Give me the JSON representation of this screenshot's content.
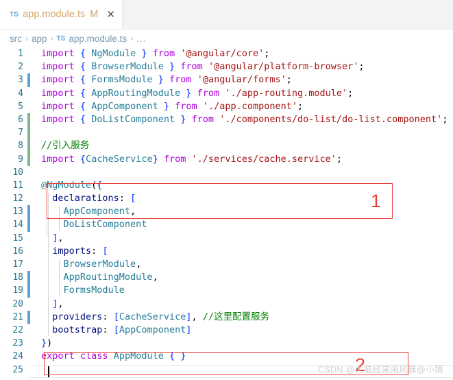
{
  "tab": {
    "file_icon": "typescript-file-icon",
    "file_icon_label": "TS",
    "filename": "app.module.ts",
    "dirty_indicator": "M",
    "close_icon": "close-icon",
    "close_glyph": "✕"
  },
  "breadcrumb": {
    "items": [
      "src",
      "app",
      "app.module.ts"
    ],
    "separator": "›",
    "ts_label": "TS",
    "overflow": "..."
  },
  "code": {
    "lines": [
      {
        "n": "1",
        "marker": "none",
        "text": "import { NgModule } from '@angular/core';"
      },
      {
        "n": "2",
        "marker": "none",
        "text": "import { BrowserModule } from '@angular/platform-browser';"
      },
      {
        "n": "3",
        "marker": "modified",
        "text": "import { FormsModule } from '@angular/forms';"
      },
      {
        "n": "4",
        "marker": "none",
        "text": "import { AppRoutingModule } from './app-routing.module';"
      },
      {
        "n": "5",
        "marker": "none",
        "text": "import { AppComponent } from './app.component';"
      },
      {
        "n": "6",
        "marker": "added",
        "text": "import { DoListComponent } from './components/do-list/do-list.component';"
      },
      {
        "n": "7",
        "marker": "added",
        "text": ""
      },
      {
        "n": "8",
        "marker": "added",
        "text": "//引入服务"
      },
      {
        "n": "9",
        "marker": "added",
        "text": "import {CacheService} from './services/cache.service';"
      },
      {
        "n": "10",
        "marker": "none",
        "text": ""
      },
      {
        "n": "11",
        "marker": "none",
        "text": "@NgModule({"
      },
      {
        "n": "12",
        "marker": "none",
        "text": "  declarations: ["
      },
      {
        "n": "13",
        "marker": "modified",
        "text": "    AppComponent,"
      },
      {
        "n": "14",
        "marker": "modified",
        "text": "    DoListComponent"
      },
      {
        "n": "15",
        "marker": "none",
        "text": "  ],"
      },
      {
        "n": "16",
        "marker": "none",
        "text": "  imports: ["
      },
      {
        "n": "17",
        "marker": "none",
        "text": "    BrowserModule,"
      },
      {
        "n": "18",
        "marker": "modified",
        "text": "    AppRoutingModule,"
      },
      {
        "n": "19",
        "marker": "modified",
        "text": "    FormsModule"
      },
      {
        "n": "20",
        "marker": "none",
        "text": "  ],"
      },
      {
        "n": "21",
        "marker": "modified",
        "text": "  providers: [CacheService], //这里配置服务"
      },
      {
        "n": "22",
        "marker": "none",
        "text": "  bootstrap: [AppComponent]"
      },
      {
        "n": "23",
        "marker": "none",
        "text": "})"
      },
      {
        "n": "24",
        "marker": "none",
        "text": "export class AppModule { }"
      },
      {
        "n": "25",
        "marker": "none",
        "text": ""
      }
    ]
  },
  "annotations": [
    {
      "id": "1",
      "label": "1",
      "target": "import-cache-service-block"
    },
    {
      "id": "2",
      "label": "2",
      "target": "providers-line"
    }
  ],
  "colors": {
    "annotation_red": "#e8413a",
    "keyword_purple": "#af00db",
    "type_teal": "#267f99",
    "string_maroon": "#a31515",
    "comment_green": "#008000",
    "property_navy": "#001080",
    "gutter_blue": "#237893",
    "change_added_green": "#81b88b",
    "change_modified_blue": "#56a2d8",
    "tab_label_orange": "#d2a364"
  },
  "watermark": {
    "text": "CSDN @大脑经常闹风暴@小猿"
  }
}
